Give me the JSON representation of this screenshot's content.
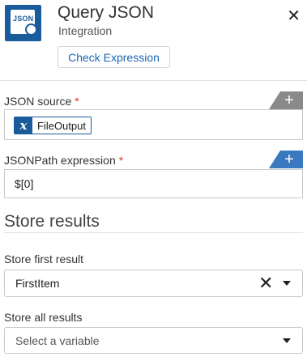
{
  "header": {
    "title": "Query JSON",
    "subtitle": "Integration",
    "check_expression_label": "Check Expression",
    "icon_text": "JSON",
    "close_glyph": "✕"
  },
  "json_source": {
    "label": "JSON source",
    "required_mark": "*",
    "add_glyph": "+",
    "variable_badge": "x",
    "variable_name": "FileOutput"
  },
  "jsonpath": {
    "label": "JSONPath expression",
    "required_mark": "*",
    "add_glyph": "+",
    "value": "$[0]"
  },
  "store_results": {
    "title": "Store results",
    "first": {
      "label": "Store first result",
      "value": "FirstItem",
      "clear_glyph": "✕"
    },
    "all": {
      "label": "Store all results",
      "placeholder": "Select a variable"
    }
  },
  "colors": {
    "brand_blue": "#1a5b9c",
    "link_blue": "#1a64b3",
    "required_red": "#d93a2b",
    "tab_gray": "#8a8a8a",
    "tab_blue": "#3a78bf"
  }
}
